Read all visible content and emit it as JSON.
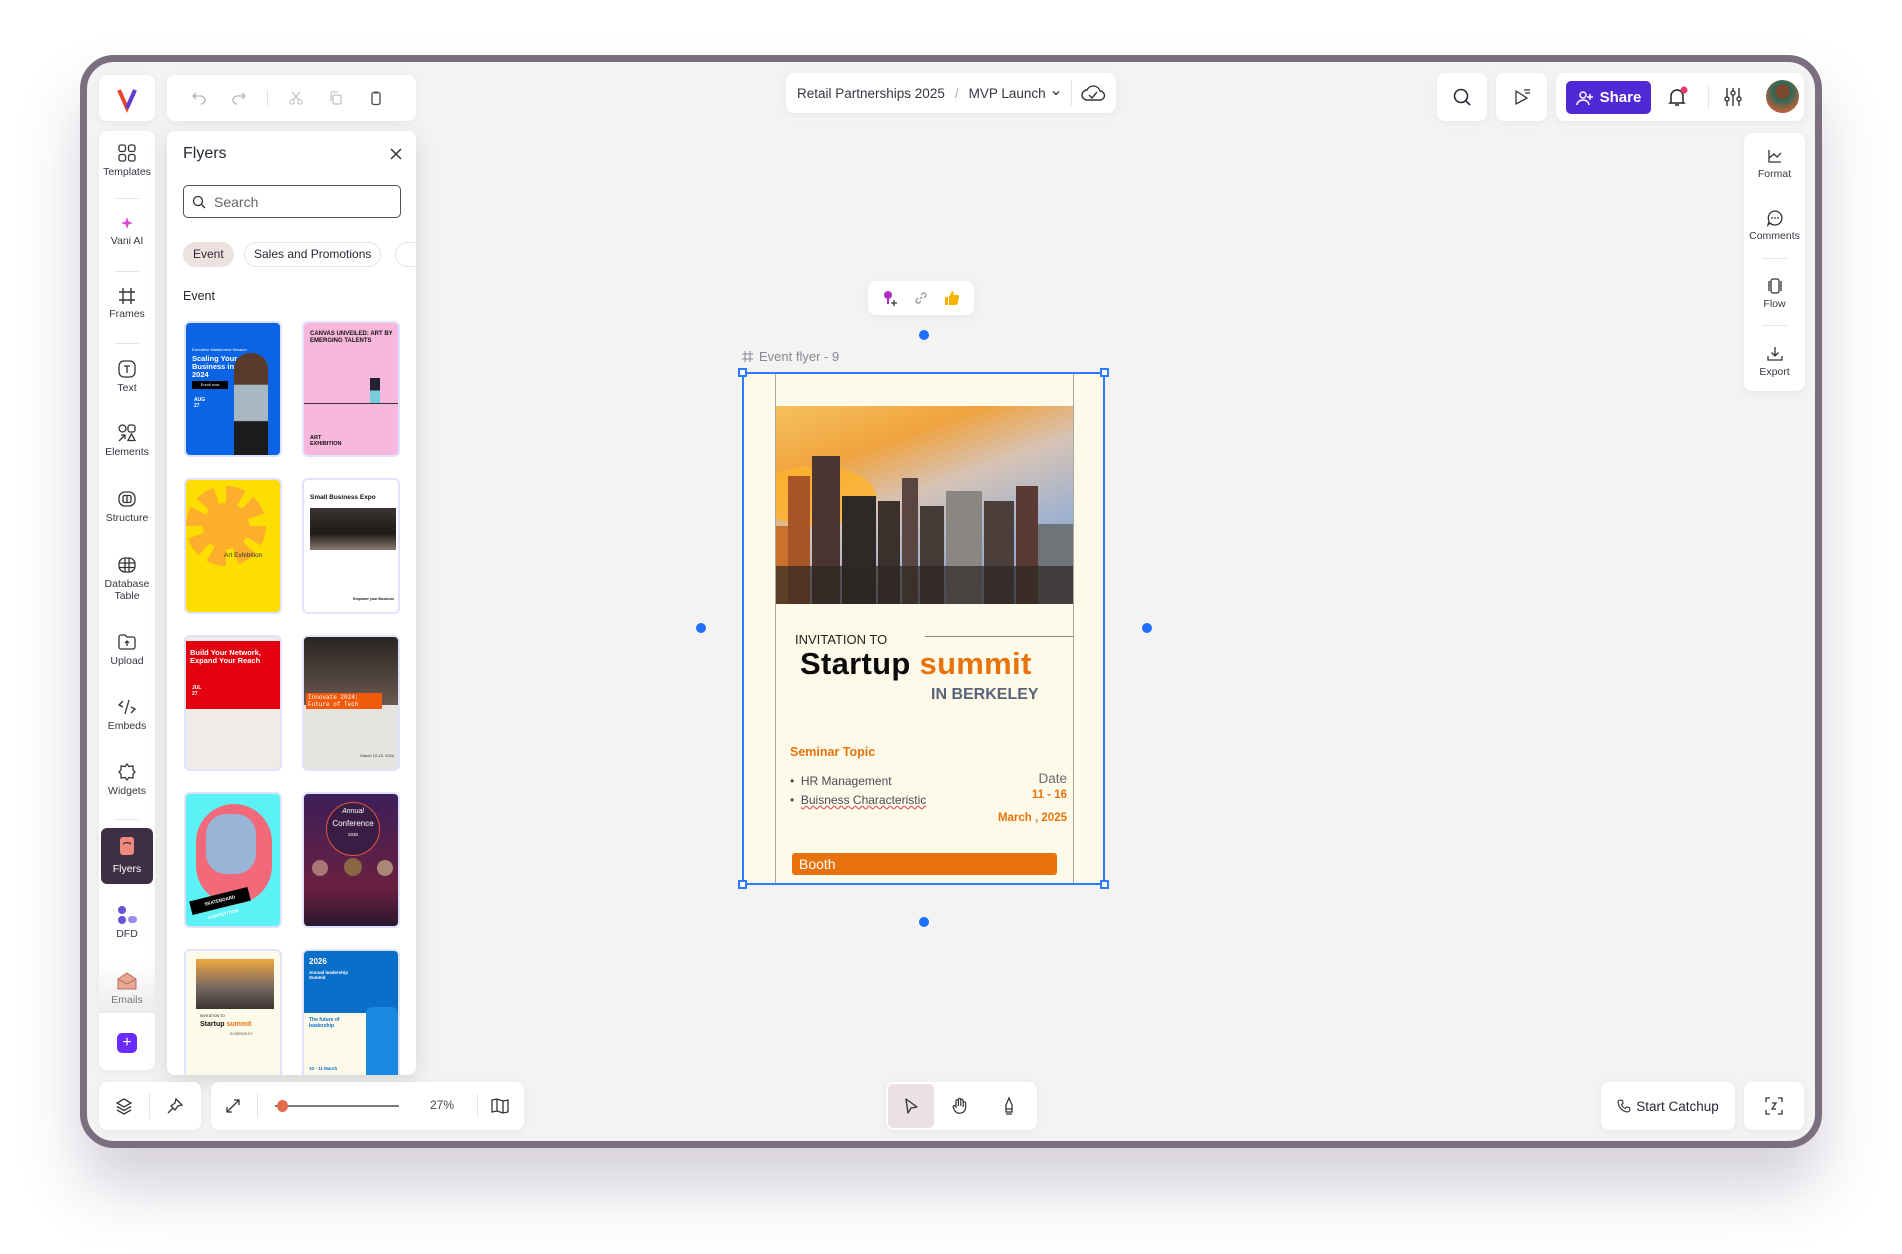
{
  "toolbar": {
    "logo": "V",
    "undo": "undo-icon",
    "redo": "redo-icon",
    "cut": "scissors-icon",
    "copy": "copy-icon",
    "paste": "clipboard-icon"
  },
  "breadcrumb": {
    "project": "Retail Partnerships 2025",
    "separator": "/",
    "page": "MVP Launch"
  },
  "header": {
    "share_label": "Share",
    "accent": "#5128d6"
  },
  "sidebar": {
    "items": [
      {
        "label": "Templates"
      },
      {
        "label": "Vani AI"
      },
      {
        "label": "Frames"
      },
      {
        "label": "Text"
      },
      {
        "label": "Elements"
      },
      {
        "label": "Structure"
      },
      {
        "label": "Database Table"
      },
      {
        "label": "Upload"
      },
      {
        "label": "Embeds"
      },
      {
        "label": "Widgets"
      },
      {
        "label": "Flyers"
      },
      {
        "label": "DFD"
      },
      {
        "label": "Emails"
      }
    ],
    "add": "+"
  },
  "panel": {
    "title": "Flyers",
    "search_placeholder": "Search",
    "chips": [
      "Event",
      "Sales and Promotions"
    ],
    "section": "Event",
    "thumbs": [
      {
        "title": "Scaling Your Business in 2024",
        "sub": "Executive Mastermind Session",
        "date": "AUG 27",
        "btn": "Enroll now"
      },
      {
        "title": "CANVAS UNVEILED: ART BY EMERGING TALENTS",
        "sub": "ART EXHIBITION"
      },
      {
        "title": "Art Exhibition"
      },
      {
        "title": "Small Business Expo",
        "sub": "Empower your Business"
      },
      {
        "title": "Build Your Network, Expand Your Reach",
        "date": "JUL 27"
      },
      {
        "title": "Innovate 2024: Future of Tech",
        "date": "March 10-15, 2024"
      },
      {
        "title": "SKATEBOARD COMPETITION"
      },
      {
        "title": "Conference",
        "sub": "Annual",
        "date": "2030"
      },
      {
        "title": "Startup",
        "accent": "summit",
        "sub": "IN BERKELEY",
        "pre": "INVITATION TO"
      },
      {
        "title": "2026",
        "sub": "Annual leadership Summit",
        "extra": "The future of leadership",
        "date": "10 - 11 March"
      }
    ]
  },
  "canvas": {
    "frame_label": "Event flyer - 9",
    "flyer": {
      "invitation": "INVITATION TO",
      "title1": "Startup",
      "title2": "summit",
      "location": "IN BERKELEY",
      "seminar_heading": "Seminar Topic",
      "topics": [
        "HR Management",
        "Buisness Characteristic"
      ],
      "date_label": "Date",
      "date_range": "11 - 16",
      "month": "March , 2025",
      "booth": "Booth",
      "orange": "#e8720c"
    }
  },
  "right_panel": {
    "items": [
      {
        "label": "Format"
      },
      {
        "label": "Comments"
      },
      {
        "label": "Flow"
      },
      {
        "label": "Export"
      }
    ]
  },
  "bottom": {
    "zoom": "27%",
    "zoom_fraction": 0.0,
    "catchup": "Start Catchup"
  }
}
